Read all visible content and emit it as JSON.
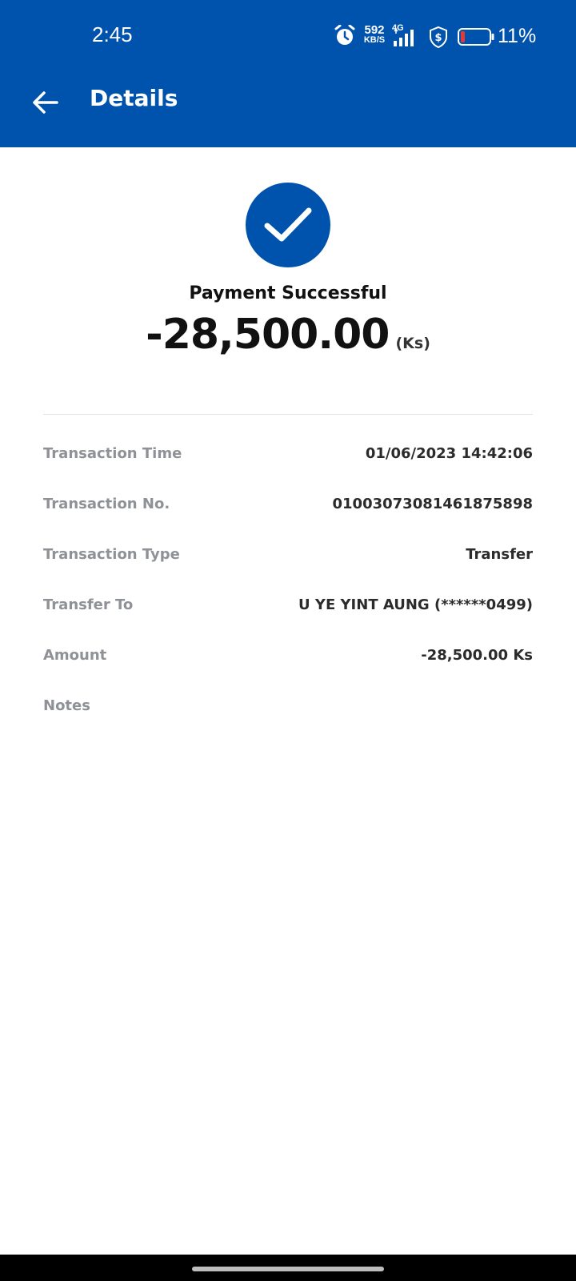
{
  "status_bar": {
    "time": "2:45",
    "net_speed": "592",
    "net_speed_unit": "KB/S",
    "network_type": "4G",
    "battery": "11%",
    "icons": [
      "alarm-icon",
      "signal-icon",
      "shield-dollar-icon",
      "battery-icon"
    ]
  },
  "header": {
    "title": "Details",
    "back_icon": "arrow-left-icon"
  },
  "summary": {
    "status": "Payment Successful",
    "amount": "-28,500.00",
    "currency": "(Ks)",
    "icon": "checkmark-icon"
  },
  "details": [
    {
      "label": "Transaction Time",
      "value": "01/06/2023 14:42:06"
    },
    {
      "label": "Transaction No.",
      "value": "01003073081461875898"
    },
    {
      "label": "Transaction Type",
      "value": "Transfer"
    },
    {
      "label": "Transfer To",
      "value": "U YE YINT AUNG (******0499)"
    },
    {
      "label": "Amount",
      "value": "-28,500.00 Ks"
    },
    {
      "label": "Notes",
      "value": ""
    }
  ],
  "colors": {
    "brand_blue": "#0053ad",
    "label_gray": "#8e9196",
    "value_dark": "#2b2b2b"
  }
}
